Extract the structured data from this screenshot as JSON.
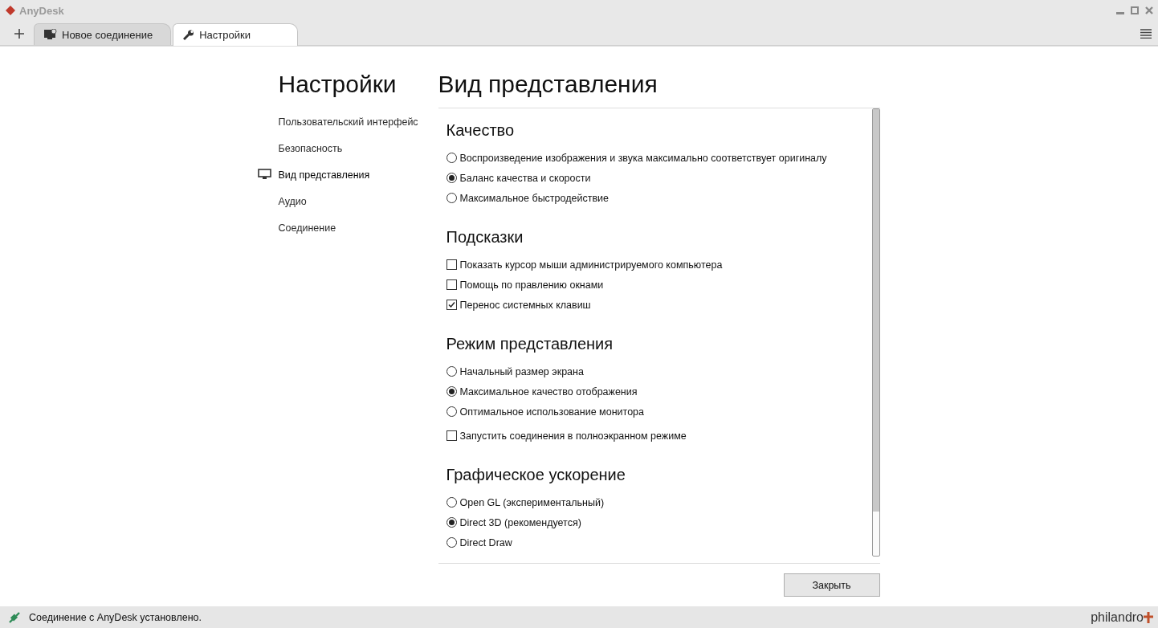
{
  "window": {
    "title": "AnyDesk"
  },
  "tabs": [
    {
      "label": "Новое соединение",
      "selected": false
    },
    {
      "label": "Настройки",
      "selected": true
    }
  ],
  "sidebar": {
    "title": "Настройки",
    "items": [
      {
        "label": "Пользовательский интерфейс",
        "selected": false
      },
      {
        "label": "Безопасность",
        "selected": false
      },
      {
        "label": "Вид представления",
        "selected": true
      },
      {
        "label": "Аудио",
        "selected": false
      },
      {
        "label": "Соединение",
        "selected": false
      }
    ]
  },
  "panel": {
    "title": "Вид представления",
    "sections": [
      {
        "title": "Качество",
        "items": [
          {
            "kind": "radio",
            "label": "Воспроизведение изображения и звука максимально соответствует оригиналу",
            "selected": false
          },
          {
            "kind": "radio",
            "label": "Баланс качества и скорости",
            "selected": true
          },
          {
            "kind": "radio",
            "label": "Максимальное быстродействие",
            "selected": false
          }
        ]
      },
      {
        "title": "Подсказки",
        "items": [
          {
            "kind": "checkbox",
            "label": "Показать курсор мыши администрируемого компьютера",
            "checked": false
          },
          {
            "kind": "checkbox",
            "label": "Помощь по правлению окнами",
            "checked": false
          },
          {
            "kind": "checkbox",
            "label": "Перенос системных клавиш",
            "checked": true
          }
        ]
      },
      {
        "title": "Режим представления",
        "items": [
          {
            "kind": "radio",
            "label": "Начальный размер экрана",
            "selected": false
          },
          {
            "kind": "radio",
            "label": "Максимальное качество отображения",
            "selected": true
          },
          {
            "kind": "radio",
            "label": "Оптимальное использование монитора",
            "selected": false
          },
          {
            "kind": "checkbox",
            "label": "Запустить соединения в полноэкранном режиме",
            "checked": false
          }
        ]
      },
      {
        "title": "Графическое ускорение",
        "items": [
          {
            "kind": "radio",
            "label": "Open GL (экспериментальный)",
            "selected": false
          },
          {
            "kind": "radio",
            "label": "Direct 3D (рекомендуется)",
            "selected": true
          },
          {
            "kind": "radio",
            "label": "Direct Draw",
            "selected": false
          }
        ]
      }
    ],
    "close_button": "Закрыть"
  },
  "status_bar": {
    "message": "Соединение с AnyDesk установлено.",
    "brand": "philandro"
  }
}
